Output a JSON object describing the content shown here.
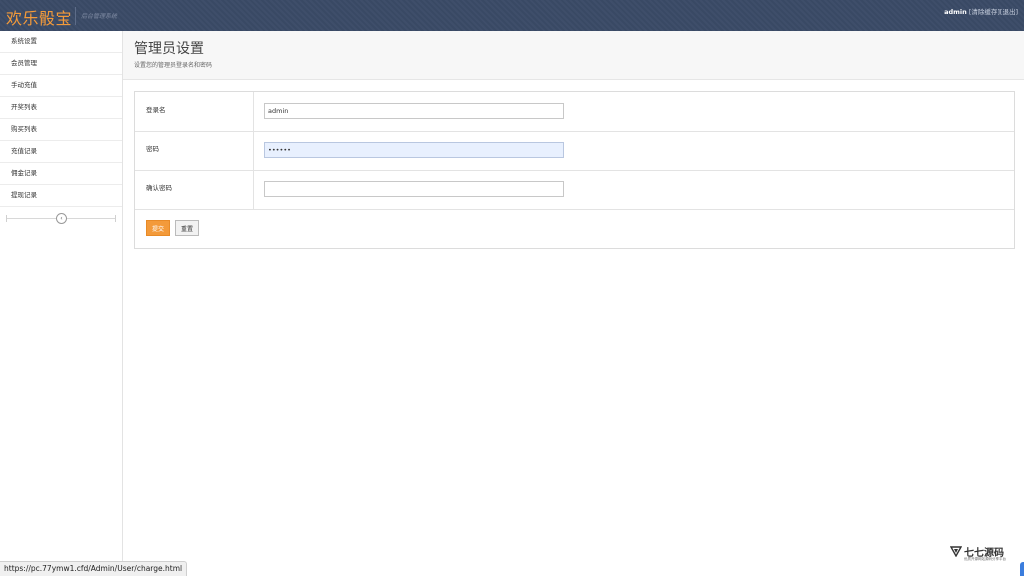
{
  "header": {
    "logo": "欢乐骰宝",
    "subtitle": "后台管理系统",
    "username": "admin",
    "clear_cache": "[清除缓存]",
    "logout": "[退出]"
  },
  "sidebar": {
    "items": [
      {
        "label": "系统设置"
      },
      {
        "label": "会员管理"
      },
      {
        "label": "手动充值"
      },
      {
        "label": "开奖列表"
      },
      {
        "label": "购买列表"
      },
      {
        "label": "充值记录"
      },
      {
        "label": "佣金记录"
      },
      {
        "label": "提现记录"
      }
    ],
    "collapse_icon": "chevron-left-icon"
  },
  "page": {
    "title": "管理员设置",
    "description": "设置您的管理员登录名和密码"
  },
  "form": {
    "login_label": "登录名",
    "login_value": "admin",
    "password_label": "密码",
    "password_value": "••••••",
    "confirm_label": "确认密码",
    "confirm_value": "",
    "submit_label": "提交",
    "reset_label": "重置"
  },
  "status_bar": {
    "url": "https://pc.77ymw1.cfd/Admin/User/charge.html"
  },
  "watermark": {
    "text": "七七源码",
    "sub": "优质开源网站源码分享平台"
  },
  "colors": {
    "header_bg": "#3a4a66",
    "accent": "#f39a3a"
  }
}
